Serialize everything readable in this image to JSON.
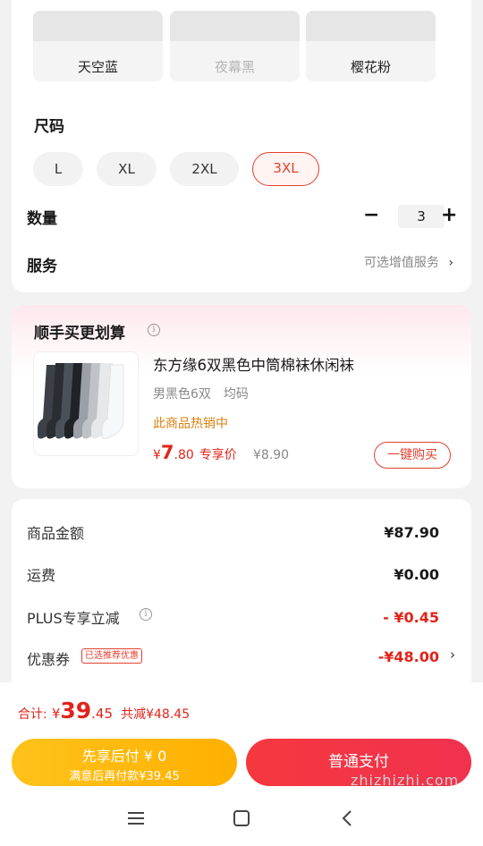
{
  "colors": {
    "items": [
      {
        "label": "天空蓝",
        "disabled": false
      },
      {
        "label": "夜幕黑",
        "disabled": true
      },
      {
        "label": "樱花粉",
        "disabled": false
      }
    ]
  },
  "size": {
    "title": "尺码",
    "options": [
      "L",
      "XL",
      "2XL",
      "3XL"
    ],
    "selected": "3XL"
  },
  "quantity": {
    "label": "数量",
    "minus": "−",
    "value": "3",
    "plus": "+"
  },
  "service": {
    "label": "服务",
    "hint": "可选增值服务",
    "chevron": "›"
  },
  "recommend": {
    "title": "顺手买更划算",
    "info": "i",
    "product": {
      "name": "东方缘6双黑色中筒棉袜休闲袜",
      "spec": "男黑色6双　均码",
      "hot": "此商品热销中",
      "price_cur": "¥",
      "price_int": "7",
      "price_dec": ".80",
      "price_tag": "专享价",
      "orig_price": "¥8.90",
      "buy_label": "一键购买"
    }
  },
  "summary": {
    "rows": [
      {
        "label": "商品金额",
        "value": "¥87.90"
      },
      {
        "label": "运费",
        "value": "¥0.00"
      },
      {
        "label": "PLUS专享立减",
        "value": "- ¥0.45"
      },
      {
        "label": "优惠券",
        "value": "-¥48.00"
      }
    ],
    "coupon_tag": "已选推荐优惠",
    "info": "i",
    "chevron": "›"
  },
  "footer": {
    "total_label": "合计:",
    "total_cur": "¥",
    "total_int": "39",
    "total_dec": ".45",
    "saved": "共减¥48.45",
    "later_title": "先享后付 ¥ 0",
    "later_sub": "满意后再付款¥39.45",
    "pay_label": "普通支付",
    "watermark": "zhizhizhi.com"
  },
  "accent": "#e2402f",
  "pay_later_color": "#ffb800",
  "pay_color": "#f23541"
}
